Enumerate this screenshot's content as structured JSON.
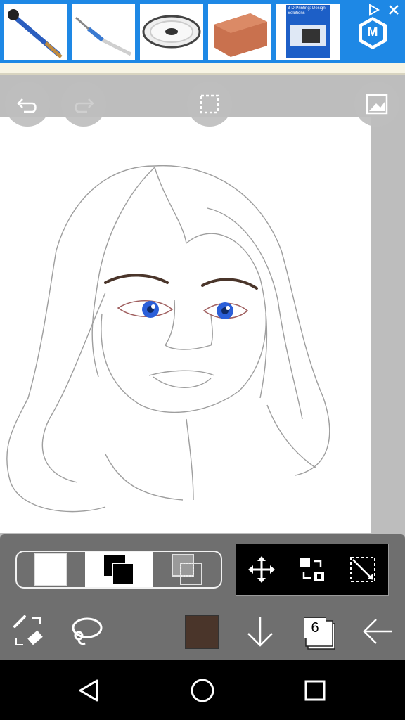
{
  "ad_banner": {
    "thumbnails": [
      "tube-brush",
      "craft-knife",
      "filament-spool",
      "clay-brick",
      "book-cover"
    ],
    "book_cover_title": "3-D Printing: Design Solutions",
    "brand_badge": "M",
    "adchoices_icon": "adchoices-icon",
    "close_icon": "close-icon"
  },
  "top_controls": {
    "undo_icon": "undo-icon",
    "redo_icon": "redo-icon",
    "selection_icon": "selection-icon",
    "image_icon": "image-icon"
  },
  "palette_bar": {
    "modes": [
      "white-fill-mode",
      "layer-stack-mode",
      "layer-clip-mode"
    ],
    "active_mode": 1,
    "transform_tools": [
      "move-icon",
      "flip-icon",
      "resize-icon"
    ]
  },
  "tools_bar": {
    "brush_eraser_icon": "brush-eraser-swap-icon",
    "lasso_icon": "lasso-icon",
    "current_color": "#4a352a",
    "download_icon": "arrow-down-icon",
    "layers_count": "6",
    "back_icon": "arrow-left-icon"
  },
  "system_nav": {
    "back": "nav-back-icon",
    "home": "nav-home-icon",
    "recents": "nav-recents-icon"
  },
  "colors": {
    "ad_blue": "#1e88e5",
    "toolbar_gray": "#6f6f6f",
    "canvas_bg": "#ffffff",
    "eye_blue": "#2b5fd9"
  }
}
